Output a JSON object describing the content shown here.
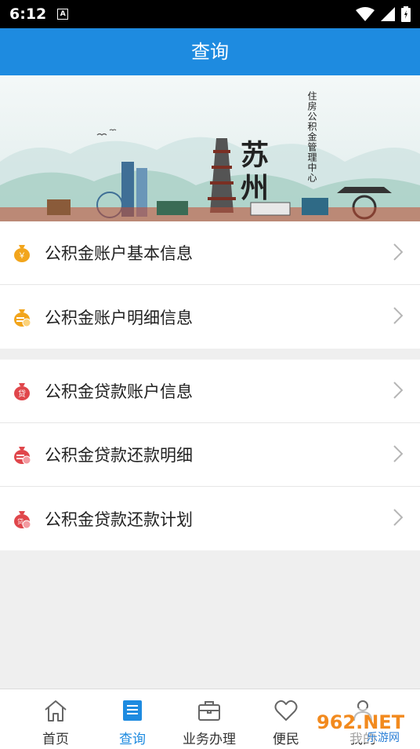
{
  "status": {
    "time": "6:12",
    "a_icon": "A"
  },
  "header": {
    "title": "查询"
  },
  "banner": {
    "city": "苏州",
    "caption": "住房公积金管理中心"
  },
  "groups": [
    {
      "items": [
        {
          "label": "公积金账户基本信息",
          "icon": "money-bag-icon",
          "icon_text": "￥"
        },
        {
          "label": "公积金账户明细信息",
          "icon": "money-bag-detail-icon"
        }
      ]
    },
    {
      "items": [
        {
          "label": "公积金贷款账户信息",
          "icon": "loan-bag-icon",
          "icon_text": "贷"
        },
        {
          "label": "公积金贷款还款明细",
          "icon": "loan-repay-detail-icon"
        },
        {
          "label": "公积金贷款还款计划",
          "icon": "loan-repay-plan-icon",
          "icon_text": "贷"
        }
      ]
    }
  ],
  "tabs": [
    {
      "label": "首页",
      "icon": "home-icon",
      "active": false
    },
    {
      "label": "查询",
      "icon": "list-icon",
      "active": true
    },
    {
      "label": "业务办理",
      "icon": "briefcase-icon",
      "active": false
    },
    {
      "label": "便民",
      "icon": "heart-icon",
      "active": false
    },
    {
      "label": "我的",
      "icon": "user-icon",
      "active": false
    }
  ],
  "watermark": {
    "text": "962.NET",
    "sub": "乐游网"
  },
  "colors": {
    "primary": "#1e8be0",
    "gold": "#f2a51c",
    "red": "#e0464b"
  }
}
